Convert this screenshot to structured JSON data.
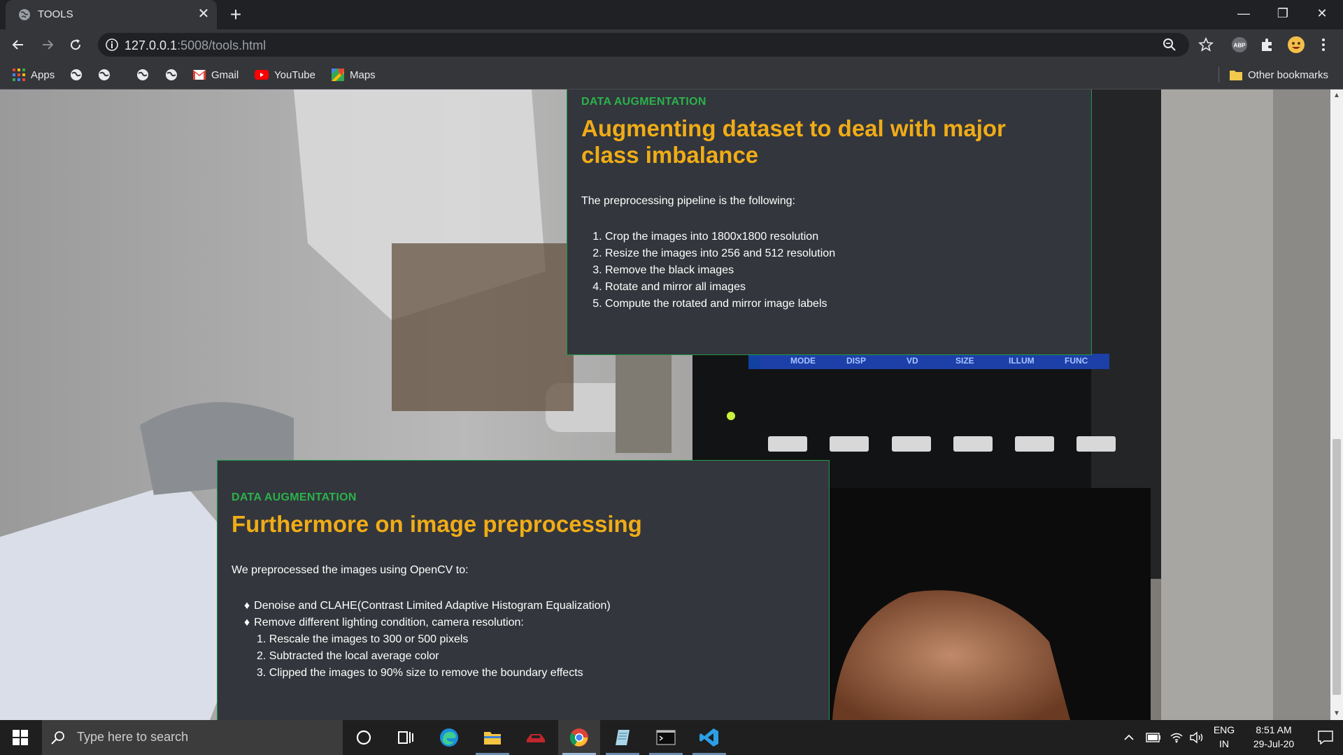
{
  "browser": {
    "tab_title": "TOOLS",
    "tab_close": "✕",
    "new_tab": "+",
    "url_host": "127.0.0.1",
    "url_rest": ":5008/tools.html",
    "window_controls": {
      "minimize": "—",
      "restore": "❐",
      "close": "✕"
    }
  },
  "bookmarks": {
    "apps": "Apps",
    "gmail": "Gmail",
    "youtube": "YouTube",
    "maps": "Maps",
    "other": "Other bookmarks"
  },
  "cards": [
    {
      "kicker": "DATA AUGMENTATION",
      "title": "Augmenting dataset to deal with major class imbalance",
      "intro": "The preprocessing pipeline is the following:",
      "steps": [
        "Crop the images into 1800x1800 resolution",
        "Resize the images into 256 and 512 resolution",
        "Remove the black images",
        "Rotate and mirror all images",
        "Compute the rotated and mirror image labels"
      ]
    },
    {
      "kicker": "DATA AUGMENTATION",
      "title": "Furthermore on image preprocessing",
      "intro": "We preprocessed the images using OpenCV to:",
      "bullets": [
        "Denoise and CLAHE(Contrast Limited Adaptive Histogram Equalization)",
        "Remove different lighting condition, camera resolution:"
      ],
      "sub_steps": [
        "1. Rescale the images to 300 or 500 pixels",
        "2. Subtracted the local average color",
        "3. Clipped the images to 90% size to remove the boundary effects"
      ]
    }
  ],
  "machine_labels": [
    "MODE",
    "DISP",
    "VD",
    "SIZE",
    "ILLUM",
    "FUNC"
  ],
  "taskbar": {
    "search_placeholder": "Type here to search",
    "lang_top": "ENG",
    "lang_bottom": "IN",
    "time": "8:51 AM",
    "date": "29-Jul-20"
  },
  "colors": {
    "kicker": "#2bb24c",
    "title": "#f0ac17",
    "card_bg": "#33363c",
    "card_border": "#1f9a4a"
  }
}
